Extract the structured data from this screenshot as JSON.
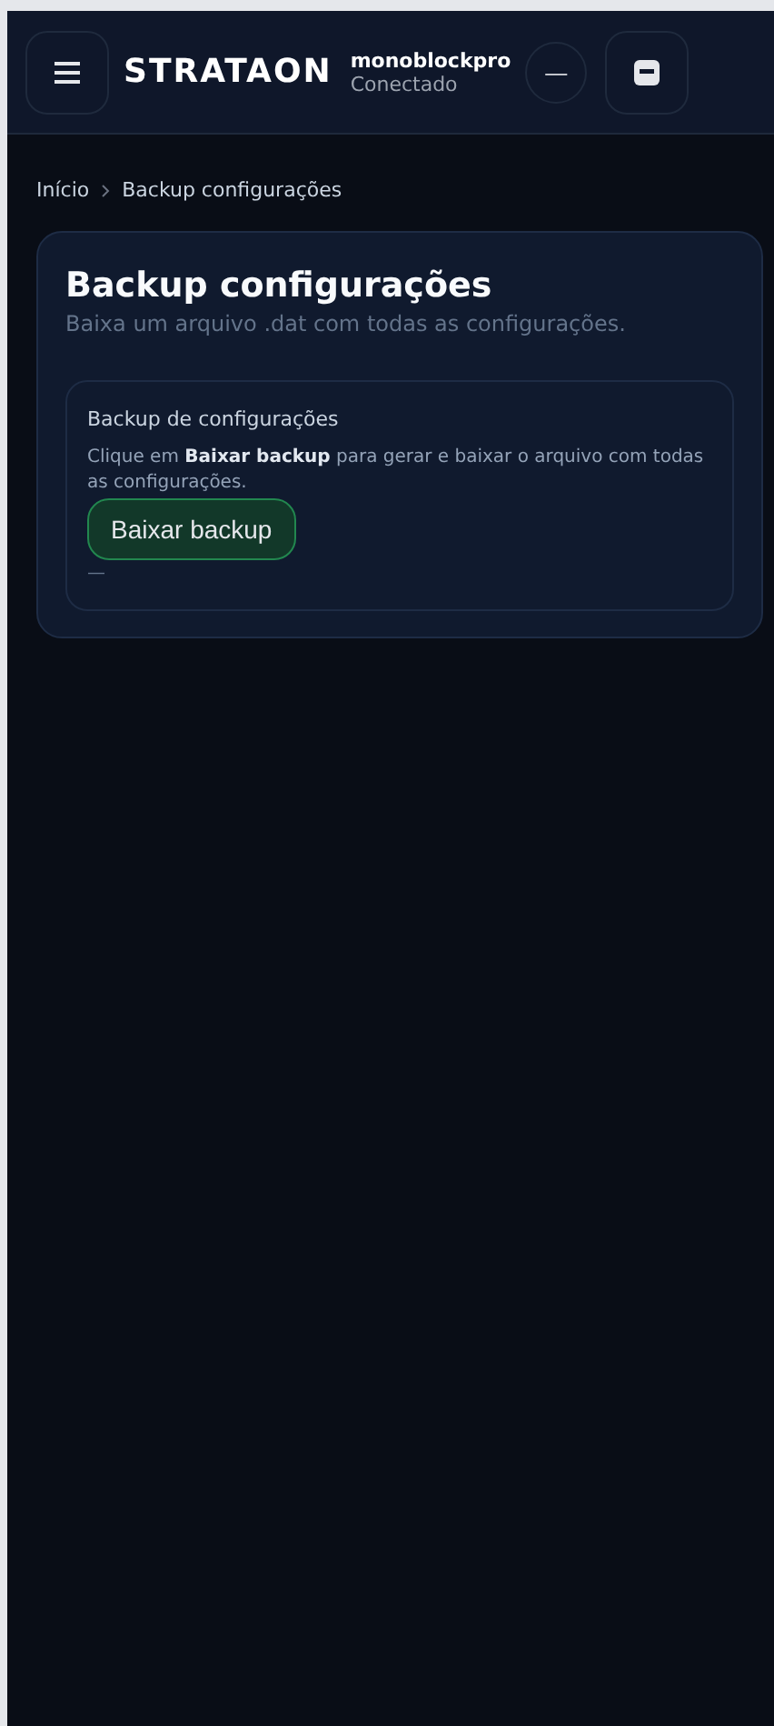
{
  "header": {
    "logo": "STRATAON",
    "device": "monoblockpro",
    "status": "Conectado",
    "round_button": "—"
  },
  "breadcrumb": [
    "Início",
    "Backup configurações"
  ],
  "card": {
    "title": "Backup configurações",
    "subtitle": "Baixa um arquivo .dat com todas as configurações.",
    "panel": {
      "title": "Backup de configurações",
      "text": "Clique em **Baixar backup** para gerar e baixar o arquivo com todas as configurações.",
      "button": "Baixar backup",
      "result": "—"
    }
  }
}
